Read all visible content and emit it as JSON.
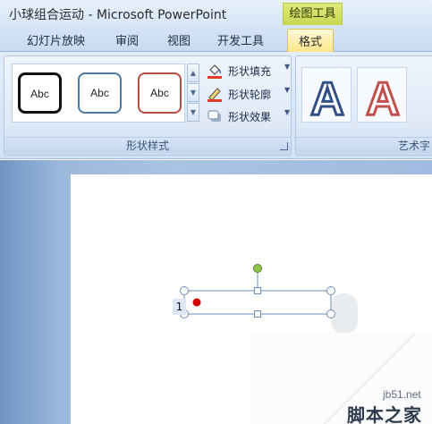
{
  "window": {
    "title": "小球组合运动 - Microsoft PowerPoint",
    "context_tab_group": "绘图工具"
  },
  "tabs": [
    {
      "label": "幻灯片放映",
      "active": false
    },
    {
      "label": "审阅",
      "active": false
    },
    {
      "label": "视图",
      "active": false
    },
    {
      "label": "开发工具",
      "active": false
    },
    {
      "label": "格式",
      "active": true
    }
  ],
  "ribbon": {
    "shape_styles": {
      "group_label": "形状样式",
      "gallery": [
        {
          "text": "Abc",
          "border_color": "#111111"
        },
        {
          "text": "Abc",
          "border_color": "#4f79a7"
        },
        {
          "text": "Abc",
          "border_color": "#b84c43"
        }
      ],
      "commands": {
        "fill": "形状填充",
        "outline": "形状轮廓",
        "effects": "形状效果"
      }
    },
    "wordart_styles": {
      "group_label": "艺术字",
      "gallery": [
        {
          "text": "A",
          "fill": "#ffffff",
          "stroke": "#2f4f86"
        },
        {
          "text": "A",
          "fill": "#ffffff",
          "stroke": "#c0504d"
        }
      ]
    }
  },
  "slide": {
    "textbox_number": "1",
    "ball_color": "#d40000",
    "handle_rotate_color": "#8fc54d"
  },
  "watermark": {
    "url": "jb51.net",
    "text": "脚本之家"
  }
}
